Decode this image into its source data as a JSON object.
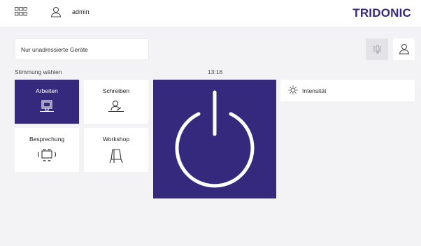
{
  "header": {
    "apps_icon": "apps-grid-icon",
    "user_icon": "user-icon",
    "username": "admin",
    "brand": "TRIDONIC",
    "brand_color": "#34297d"
  },
  "toolbar": {
    "filter_label": "Nur unadressierte Geräte",
    "identify_icon": "identify-icon",
    "profile_icon": "user-icon"
  },
  "scenes": {
    "section_label": "Stimmung wählen",
    "items": [
      {
        "label": "Arbeiten",
        "icon": "desk-monitor-icon",
        "active": true
      },
      {
        "label": "Schreiben",
        "icon": "person-writing-icon",
        "active": false
      },
      {
        "label": "Besprechung",
        "icon": "meeting-table-icon",
        "active": false
      },
      {
        "label": "Workshop",
        "icon": "flipchart-icon",
        "active": false
      }
    ]
  },
  "clock": "13:16",
  "power": {
    "icon": "power-icon",
    "color": "#34297d"
  },
  "intensity": {
    "label": "Intensität",
    "icon": "sun-icon"
  }
}
